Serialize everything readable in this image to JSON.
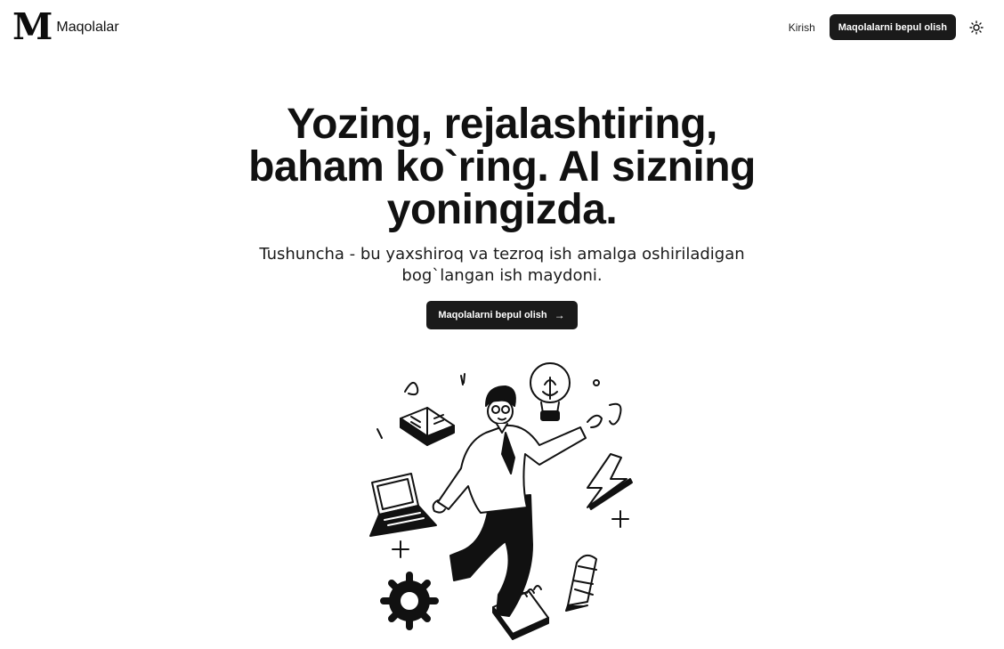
{
  "header": {
    "logo_letter": "M",
    "brand_name": "Maqolalar",
    "login_label": "Kirish",
    "cta_label": "Maqolalarni bepul olish",
    "theme_icon": "sun-icon"
  },
  "hero": {
    "title": "Yozing, rejalashtiring, baham ko`ring. AI sizning yoningizda.",
    "subtitle": "Tushuncha - bu yaxshiroq va tezroq ish amalga oshiriladigan bog`langan ish maydoni.",
    "cta_label": "Maqolalarni bepul olish",
    "cta_icon": "arrow-right-icon"
  },
  "colors": {
    "background": "#ffffff",
    "text": "#111111",
    "button_bg": "#1a1a1a",
    "button_text": "#ffffff"
  }
}
